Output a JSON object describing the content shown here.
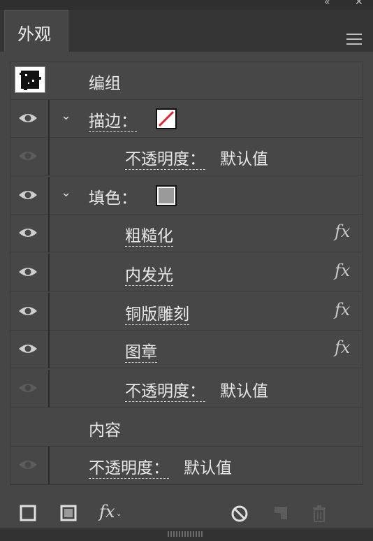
{
  "panel": {
    "tab_label": "外观",
    "menu_icon": "hamburger-menu-icon"
  },
  "rows": {
    "group": {
      "label": "编组"
    },
    "stroke": {
      "label": "描边：",
      "swatch_color": "#e0202a"
    },
    "stroke_opacity": {
      "label": "不透明度：",
      "value": "默认值"
    },
    "fill": {
      "label": "填色：",
      "swatch_color": "#9a9a9a"
    },
    "effect1": {
      "label": "粗糙化",
      "fx": "fx"
    },
    "effect2": {
      "label": "内发光",
      "fx": "fx"
    },
    "effect3": {
      "label": "铜版雕刻",
      "fx": "fx"
    },
    "effect4": {
      "label": "图章",
      "fx": "fx"
    },
    "fill_opacity": {
      "label": "不透明度：",
      "value": "默认值"
    },
    "contents": {
      "label": "内容"
    },
    "opacity": {
      "label": "不透明度：",
      "value": "默认值"
    }
  },
  "footer": {
    "fx_label": "fx"
  },
  "colors": {
    "panel_bg": "#464646",
    "tab_bar_bg": "#353535",
    "text": "#e8e8e8"
  }
}
